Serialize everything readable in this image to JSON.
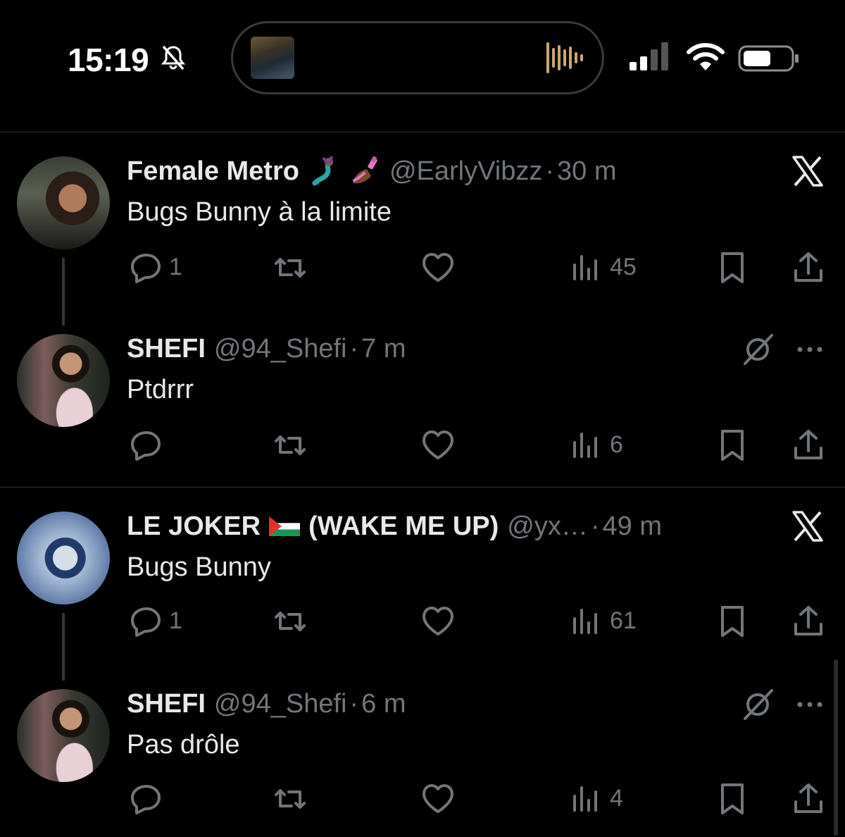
{
  "status_bar": {
    "time": "15:19"
  },
  "tweets": [
    {
      "display_name": "Female Metro",
      "handle": "@EarlyVibzz",
      "separator": "·",
      "time": "30 m",
      "text": "Bugs Bunny à la limite",
      "replies": "1",
      "views": "45"
    },
    {
      "display_name": "SHEFI",
      "handle": "@94_Shefi",
      "separator": "·",
      "time": "7 m",
      "text": "Ptdrrr",
      "replies": "",
      "views": "6"
    },
    {
      "display_name": "LE JOKER",
      "display_name_suffix": "(WAKE ME UP)",
      "handle": "@yx…",
      "separator": "·",
      "time": "49 m",
      "text": "Bugs Bunny",
      "replies": "1",
      "views": "61"
    },
    {
      "display_name": "SHEFI",
      "handle": "@94_Shefi",
      "separator": "·",
      "time": "6 m",
      "text": "Pas drôle",
      "replies": "",
      "views": "4"
    }
  ],
  "icons": {
    "close": "x-logo-icon",
    "reply": "reply-icon",
    "retweet": "retweet-icon",
    "like": "heart-icon",
    "views": "views-icon",
    "bookmark": "bookmark-icon",
    "share": "share-icon",
    "more": "more-icon",
    "muted": "muted-icon"
  },
  "colors": {
    "background": "#000000",
    "text": "#e7e9ea",
    "secondary": "#71767b"
  }
}
